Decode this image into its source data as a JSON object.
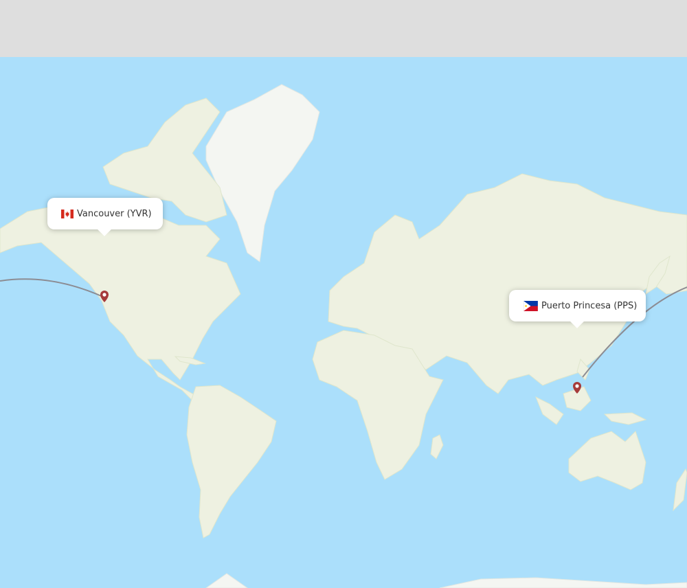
{
  "map": {
    "route": {
      "origin": {
        "city": "Vancouver",
        "code": "YVR",
        "country": "Canada",
        "label": "Vancouver (YVR)",
        "flag_icon": "canada-flag-icon"
      },
      "destination": {
        "city": "Puerto Princesa",
        "code": "PPS",
        "country": "Philippines",
        "label": "Puerto Princesa (PPS)",
        "flag_icon": "philippines-flag-icon"
      }
    },
    "colors": {
      "ocean": "#abdffb",
      "land": "#eef1e1",
      "route_line": "#8c8c93",
      "marker": "#a63b3b",
      "header_band": "#dedede"
    }
  }
}
